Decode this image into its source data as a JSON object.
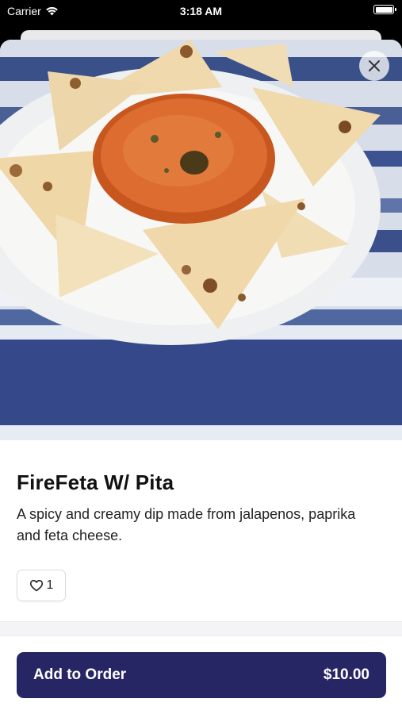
{
  "status_bar": {
    "carrier": "Carrier",
    "time": "3:18 AM"
  },
  "item": {
    "title": "FireFeta W/ Pita",
    "description": "A spicy and creamy dip made from jalapenos, paprika and feta cheese.",
    "like_count": "1"
  },
  "order_button": {
    "label": "Add to Order",
    "price": "$10.00"
  },
  "colors": {
    "accent": "#272665",
    "dip": "#d9682f",
    "pita": "#f2dfb9",
    "tablecloth": "#3a5088"
  },
  "icons": {
    "close": "close-icon",
    "like": "heart-icon",
    "wifi": "wifi-icon",
    "battery": "battery-icon"
  }
}
